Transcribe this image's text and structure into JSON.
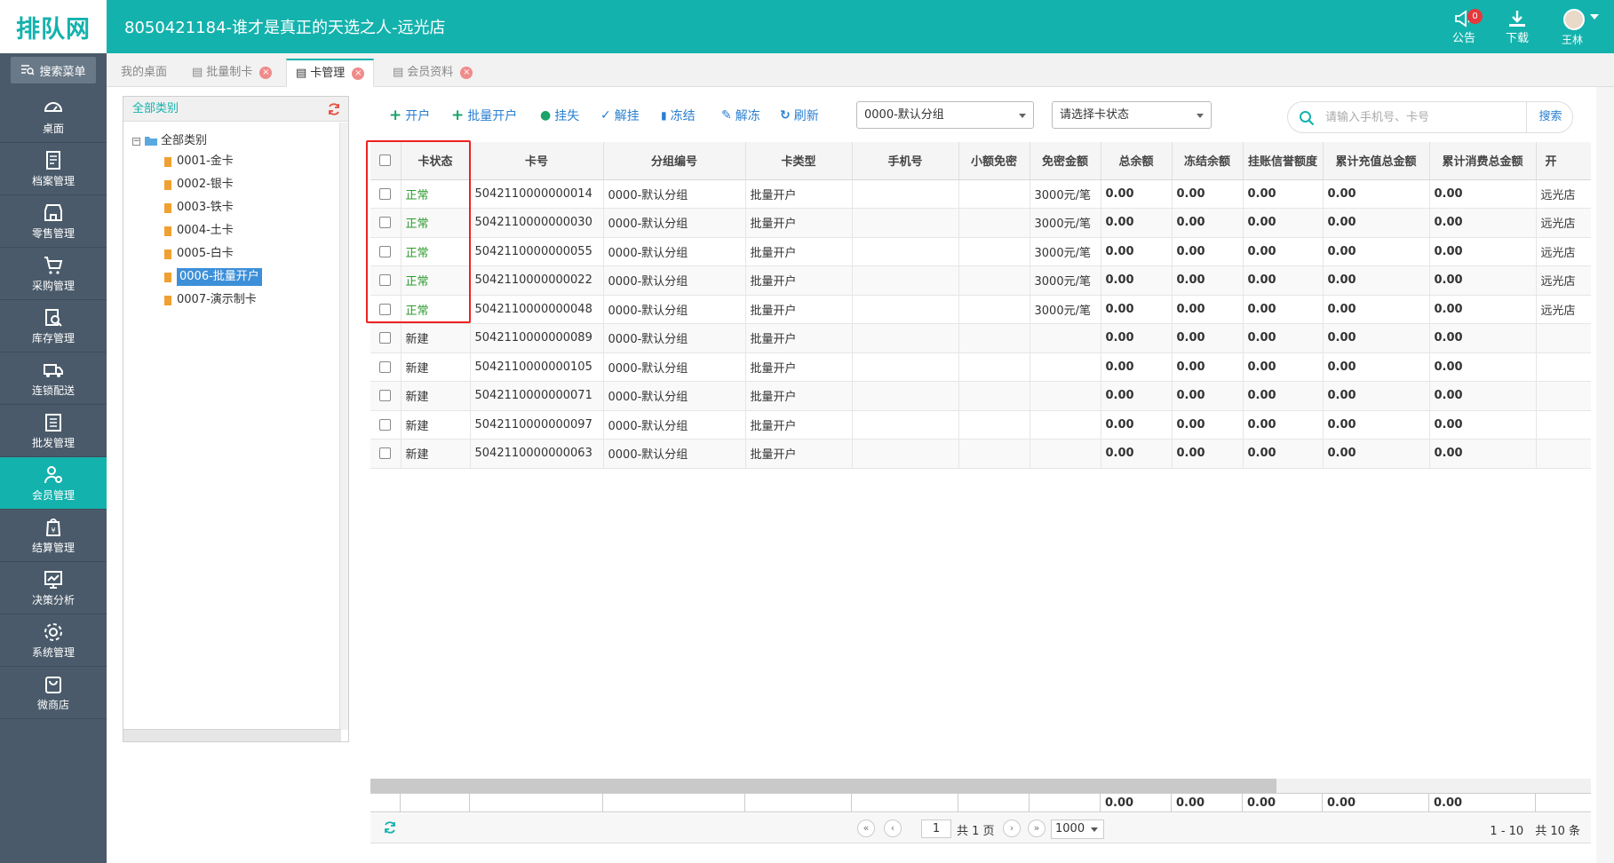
{
  "header": {
    "logo": "排队网",
    "title": "8050421184-谁才是真正的天选之人-远光店",
    "notice_label": "公告",
    "notice_count": "0",
    "download_label": "下载",
    "user_name": "王林"
  },
  "sidebar": {
    "search_menu": "搜索菜单",
    "items": [
      {
        "label": "桌面",
        "icon": "dashboard-icon"
      },
      {
        "label": "档案管理",
        "icon": "archive-icon"
      },
      {
        "label": "零售管理",
        "icon": "store-icon"
      },
      {
        "label": "采购管理",
        "icon": "cart-icon"
      },
      {
        "label": "库存管理",
        "icon": "inventory-icon"
      },
      {
        "label": "连锁配送",
        "icon": "truck-icon"
      },
      {
        "label": "批发管理",
        "icon": "wholesale-icon"
      },
      {
        "label": "会员管理",
        "icon": "member-icon"
      },
      {
        "label": "结算管理",
        "icon": "settlement-icon"
      },
      {
        "label": "决策分析",
        "icon": "analysis-icon"
      },
      {
        "label": "系统管理",
        "icon": "gear-icon"
      },
      {
        "label": "微商店",
        "icon": "shop-bag-icon"
      }
    ],
    "active_index": 7
  },
  "tabs": [
    {
      "label": "我的桌面"
    },
    {
      "label": "批量制卡"
    },
    {
      "label": "卡管理"
    },
    {
      "label": "会员资料"
    }
  ],
  "tree": {
    "header": "全部类别",
    "root": "全部类别",
    "nodes": [
      "0001-金卡",
      "0002-银卡",
      "0003-铁卡",
      "0004-土卡",
      "0005-白卡",
      "0006-批量开户",
      "0007-演示制卡"
    ],
    "selected_index": 5
  },
  "toolbar": {
    "open_account": "开户",
    "batch_open": "批量开户",
    "report_loss": "挂失",
    "unlink_loss": "解挂",
    "freeze": "冻结",
    "unfreeze": "解冻",
    "refresh": "刷新",
    "group_select": "0000-默认分组",
    "status_select": "请选择卡状态",
    "search_placeholder": "请输入手机号、卡号",
    "search_button": "搜索"
  },
  "table": {
    "columns": [
      "卡状态",
      "卡号",
      "分组编号",
      "卡类型",
      "手机号",
      "小额免密",
      "免密金额",
      "总余额",
      "冻结余额",
      "挂账信誉额度",
      "累计充值总金额",
      "累计消费总金额",
      "开"
    ],
    "rows": [
      {
        "status": "正常",
        "card": "5042110000000014",
        "group": "0000-默认分组",
        "type": "批量开户",
        "phone": "",
        "small": "",
        "free": "3000元/笔",
        "total": "0.00",
        "frozen": "0.00",
        "credit": "0.00",
        "recharge": "0.00",
        "consume": "0.00",
        "store": "远光店"
      },
      {
        "status": "正常",
        "card": "5042110000000030",
        "group": "0000-默认分组",
        "type": "批量开户",
        "phone": "",
        "small": "",
        "free": "3000元/笔",
        "total": "0.00",
        "frozen": "0.00",
        "credit": "0.00",
        "recharge": "0.00",
        "consume": "0.00",
        "store": "远光店"
      },
      {
        "status": "正常",
        "card": "5042110000000055",
        "group": "0000-默认分组",
        "type": "批量开户",
        "phone": "",
        "small": "",
        "free": "3000元/笔",
        "total": "0.00",
        "frozen": "0.00",
        "credit": "0.00",
        "recharge": "0.00",
        "consume": "0.00",
        "store": "远光店"
      },
      {
        "status": "正常",
        "card": "5042110000000022",
        "group": "0000-默认分组",
        "type": "批量开户",
        "phone": "",
        "small": "",
        "free": "3000元/笔",
        "total": "0.00",
        "frozen": "0.00",
        "credit": "0.00",
        "recharge": "0.00",
        "consume": "0.00",
        "store": "远光店"
      },
      {
        "status": "正常",
        "card": "5042110000000048",
        "group": "0000-默认分组",
        "type": "批量开户",
        "phone": "",
        "small": "",
        "free": "3000元/笔",
        "total": "0.00",
        "frozen": "0.00",
        "credit": "0.00",
        "recharge": "0.00",
        "consume": "0.00",
        "store": "远光店"
      },
      {
        "status": "新建",
        "card": "5042110000000089",
        "group": "0000-默认分组",
        "type": "批量开户",
        "phone": "",
        "small": "",
        "free": "",
        "total": "0.00",
        "frozen": "0.00",
        "credit": "0.00",
        "recharge": "0.00",
        "consume": "0.00",
        "store": ""
      },
      {
        "status": "新建",
        "card": "5042110000000105",
        "group": "0000-默认分组",
        "type": "批量开户",
        "phone": "",
        "small": "",
        "free": "",
        "total": "0.00",
        "frozen": "0.00",
        "credit": "0.00",
        "recharge": "0.00",
        "consume": "0.00",
        "store": ""
      },
      {
        "status": "新建",
        "card": "5042110000000071",
        "group": "0000-默认分组",
        "type": "批量开户",
        "phone": "",
        "small": "",
        "free": "",
        "total": "0.00",
        "frozen": "0.00",
        "credit": "0.00",
        "recharge": "0.00",
        "consume": "0.00",
        "store": ""
      },
      {
        "status": "新建",
        "card": "5042110000000097",
        "group": "0000-默认分组",
        "type": "批量开户",
        "phone": "",
        "small": "",
        "free": "",
        "total": "0.00",
        "frozen": "0.00",
        "credit": "0.00",
        "recharge": "0.00",
        "consume": "0.00",
        "store": ""
      },
      {
        "status": "新建",
        "card": "5042110000000063",
        "group": "0000-默认分组",
        "type": "批量开户",
        "phone": "",
        "small": "",
        "free": "",
        "total": "0.00",
        "frozen": "0.00",
        "credit": "0.00",
        "recharge": "0.00",
        "consume": "0.00",
        "store": ""
      }
    ],
    "footer_totals": [
      "0.00",
      "0.00",
      "0.00",
      "0.00",
      "0.00"
    ]
  },
  "pager": {
    "page": "1",
    "total_pages": "共 1 页",
    "page_size": "1000",
    "info": "1 - 10　共 10 条"
  },
  "colors": {
    "brand": "#14b2ad",
    "sidebar": "#4a5a6a",
    "link": "#2a7fd0",
    "status_ok": "#2e9a2e",
    "highlight": "#e22222"
  }
}
